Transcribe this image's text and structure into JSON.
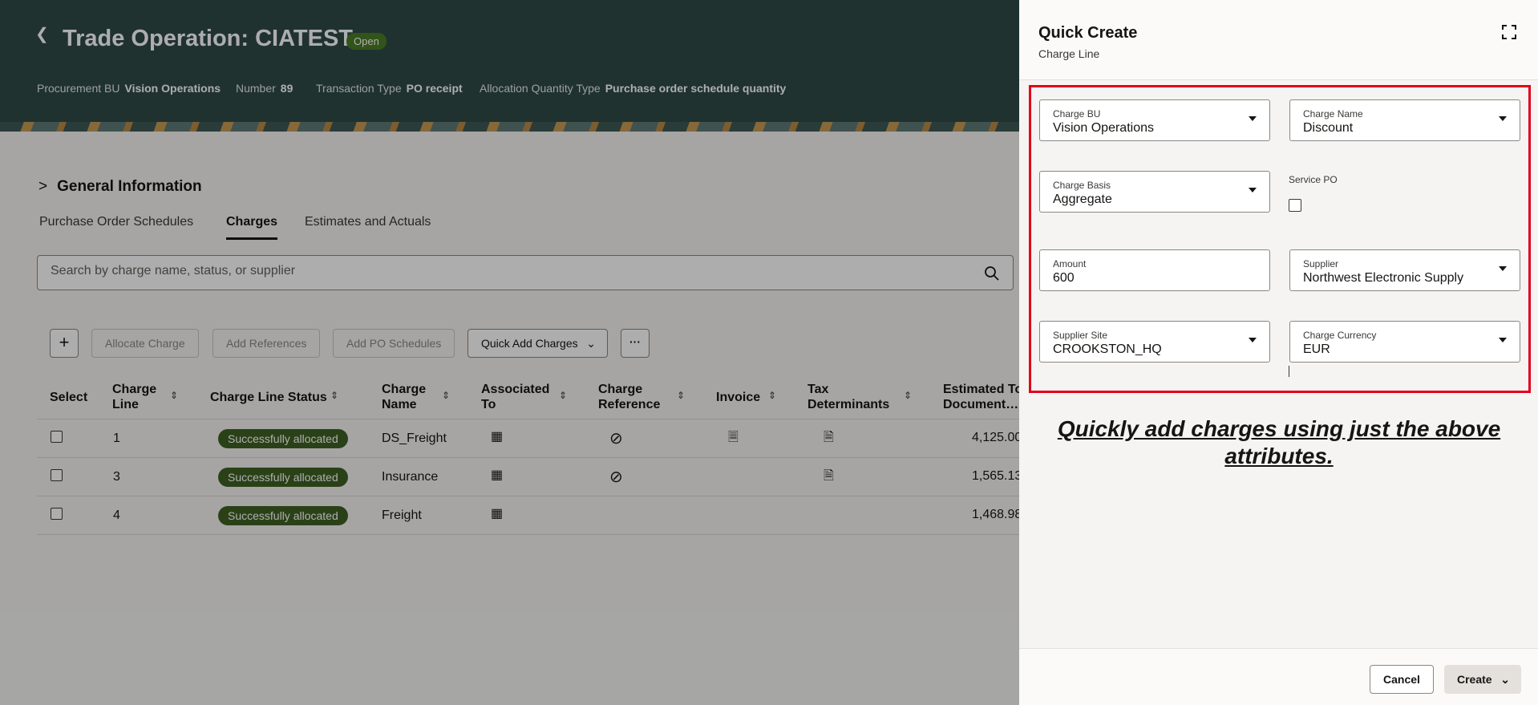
{
  "header": {
    "back_icon": "chevron-left-icon",
    "title": "Trade Operation: CIATEST",
    "status_badge": "Open",
    "meta": [
      {
        "label": "Procurement BU",
        "value": "Vision Operations"
      },
      {
        "label": "Number",
        "value": "89"
      },
      {
        "label": "Transaction Type",
        "value": "PO receipt"
      },
      {
        "label": "Allocation Quantity Type",
        "value": "Purchase order schedule quantity"
      }
    ]
  },
  "section": {
    "title": "General Information"
  },
  "tabs": [
    "Purchase Order Schedules",
    "Charges",
    "Estimates and Actuals"
  ],
  "active_tab": "Charges",
  "search": {
    "placeholder": "Search by charge name, status, or supplier"
  },
  "toolbar": {
    "add_icon": "plus-icon",
    "allocate_charge": "Allocate Charge",
    "add_references": "Add References",
    "add_po_schedules": "Add PO Schedules",
    "quick_add_charges": "Quick Add Charges",
    "more_icon": "ellipsis-icon"
  },
  "table": {
    "columns": [
      "Select",
      "Charge Line",
      "Charge Line Status",
      "Charge Name",
      "Associated To",
      "Charge Reference",
      "Invoice",
      "Tax Determinants",
      "Estimated To Document…"
    ],
    "rows": [
      {
        "line": "1",
        "status": "Successfully allocated",
        "name": "DS_Freight",
        "estimated": "4,125.00"
      },
      {
        "line": "3",
        "status": "Successfully allocated",
        "name": "Insurance",
        "estimated": "1,565.13"
      },
      {
        "line": "4",
        "status": "Successfully allocated",
        "name": "Freight",
        "estimated": "1,468.98"
      }
    ]
  },
  "drawer": {
    "title": "Quick Create",
    "subtitle": "Charge Line",
    "expand_icon": "expand-icon",
    "fields": {
      "charge_bu": {
        "label": "Charge BU",
        "value": "Vision Operations"
      },
      "charge_name": {
        "label": "Charge Name",
        "value": "Discount"
      },
      "charge_basis": {
        "label": "Charge Basis",
        "value": "Aggregate"
      },
      "service_po": {
        "label": "Service PO",
        "checked": false
      },
      "amount": {
        "label": "Amount",
        "value": "600"
      },
      "supplier": {
        "label": "Supplier",
        "value": "Northwest Electronic Supply"
      },
      "supplier_site": {
        "label": "Supplier Site",
        "value": "CROOKSTON_HQ"
      },
      "charge_currency": {
        "label": "Charge Currency",
        "value": "EUR"
      }
    },
    "note": "Quickly add charges using just the above attributes.",
    "cancel": "Cancel",
    "create": "Create"
  },
  "colors": {
    "header_bg": "#2f4a47",
    "badge_green": "#4b7b26",
    "status_green": "#3f6123",
    "highlight_red": "#e2001a"
  }
}
